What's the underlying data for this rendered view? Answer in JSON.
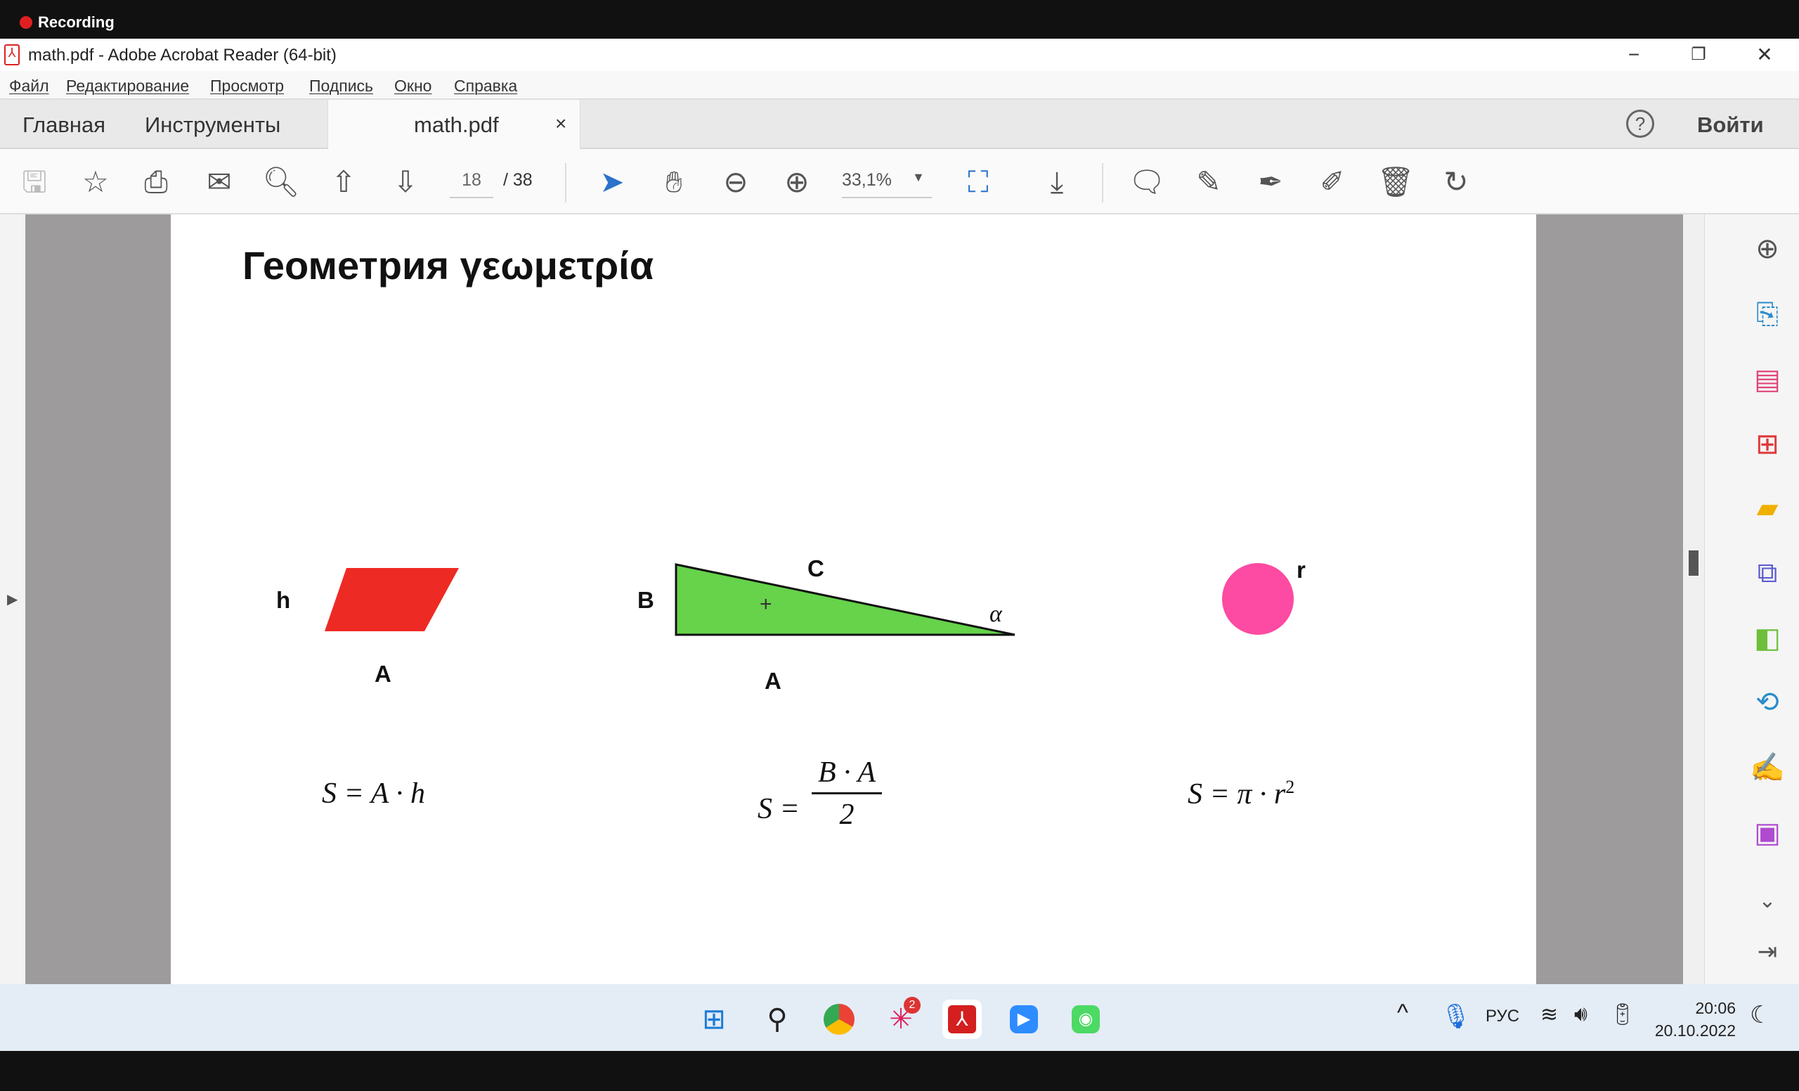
{
  "recording": {
    "label": "Recording"
  },
  "window": {
    "title": "math.pdf - Adobe Acrobat Reader (64-bit)",
    "minimize": "−",
    "restore": "❐",
    "close": "✕"
  },
  "menu": [
    "Файл",
    "Редактирование",
    "Просмотр",
    "Подпись",
    "Окно",
    "Справка"
  ],
  "tabs": {
    "home": "Главная",
    "tools": "Инструменты",
    "document": "math.pdf",
    "close": "×",
    "signin": "Войти",
    "help": "?"
  },
  "toolbar": {
    "page_current": "18",
    "page_total": "/ 38",
    "zoom": "33,1%"
  },
  "document": {
    "title": "Геометрия γεωμετρία",
    "parallelogram": {
      "color": "#ee2a24",
      "h": "h",
      "a": "A",
      "formula": "S = A · h"
    },
    "triangle": {
      "color": "#66d34a",
      "b": "B",
      "c": "C",
      "alpha": "α",
      "a": "A",
      "formula_lhs": "S =",
      "numerator": "B · A",
      "denominator": "2"
    },
    "circle": {
      "color": "#fd4aa2",
      "r": "r",
      "formula": "S = π · r",
      "exponent": "2"
    }
  },
  "taskbar": {
    "lang": "РУС",
    "time": "20:06",
    "date": "20.10.2022",
    "slack_badge": "2"
  }
}
